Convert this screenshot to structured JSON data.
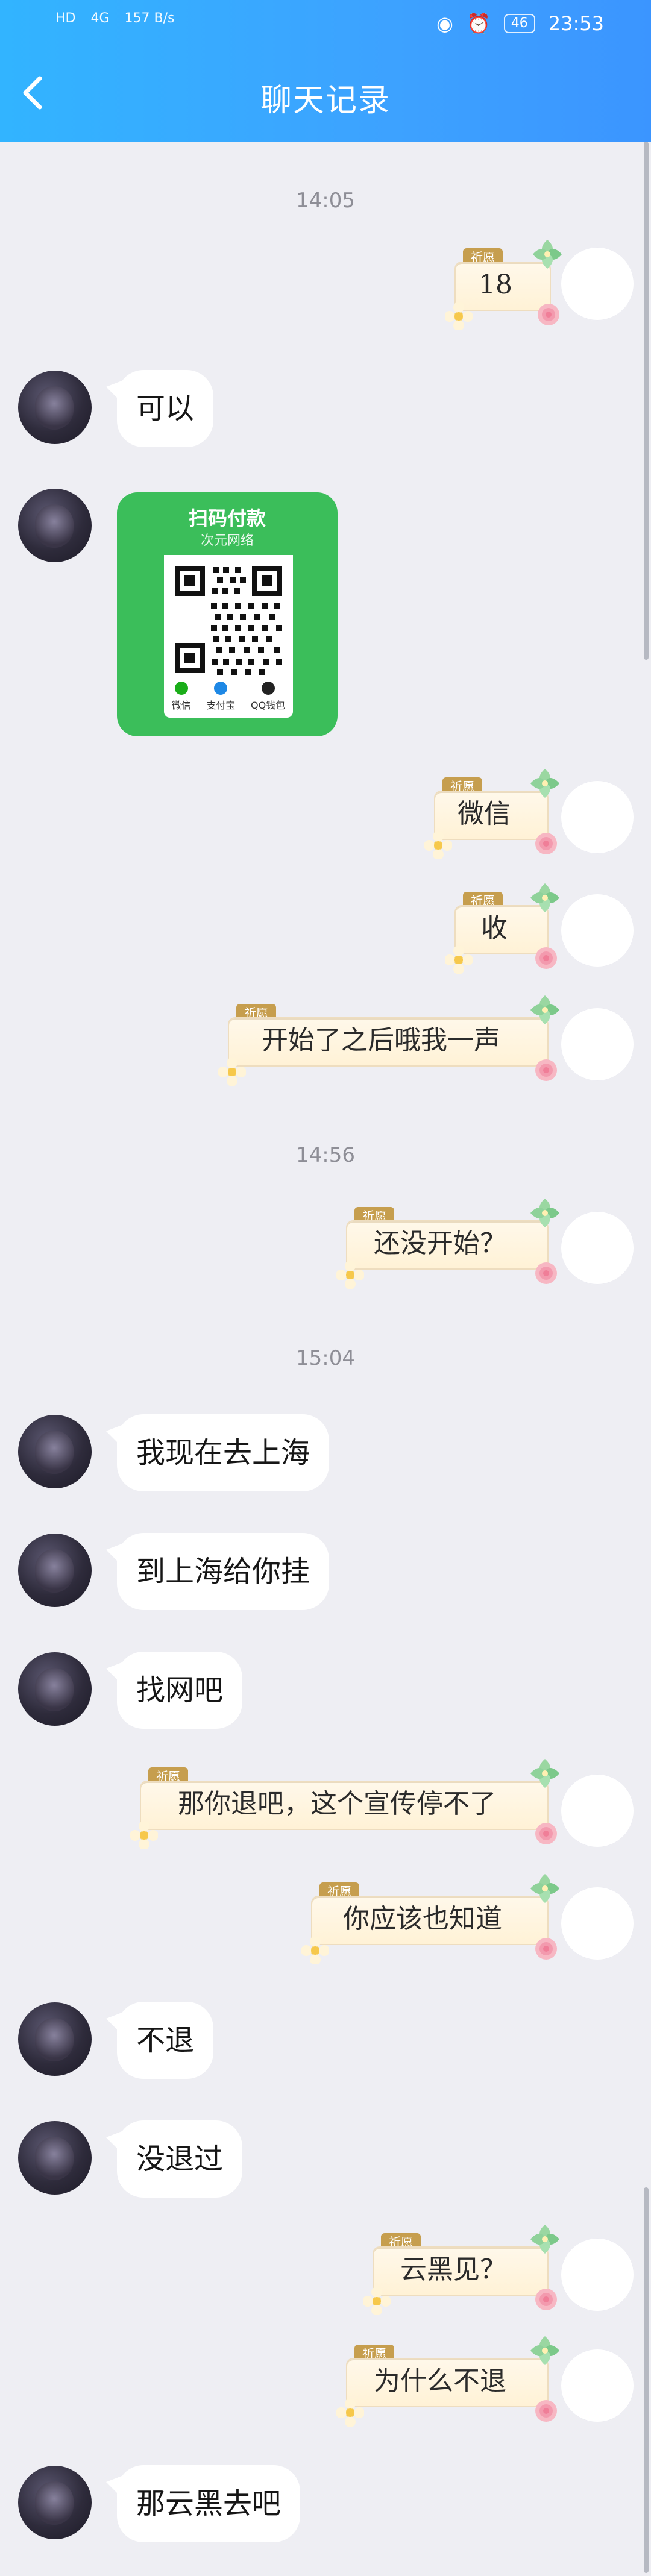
{
  "status": {
    "left": [
      "HD",
      "4G",
      "157 B/s"
    ],
    "right_time": "23:53",
    "battery": "46"
  },
  "header": {
    "title": "聊天记录",
    "back_icon": "chevron-left-icon"
  },
  "messages": {
    "time_1": "14:05",
    "time_2": "14:56",
    "time_3": "15:04",
    "r1": "18",
    "l1": "可以",
    "qr": {
      "title": "扫码付款",
      "subtitle": "次元网络",
      "icons": [
        "微信",
        "支付宝",
        "QQ钱包"
      ]
    },
    "r2": "微信",
    "r3": "收",
    "r4": "开始了之后哦我一声",
    "r5": "还没开始？",
    "l2": "我现在去上海",
    "l3": "到上海给你挂",
    "l4": "找网吧",
    "r6": "那你退吧，这个宣传停不了",
    "r7": "你应该也知道",
    "l5": "不退",
    "l6": "没退过",
    "r8": "云黑见？",
    "r9": "为什么不退",
    "l7": "那云黑去吧"
  },
  "tags": {
    "sender_tag": "祈愿"
  },
  "colors": {
    "header_start": "#32B4FF",
    "header_end": "#3B95FF",
    "bg": "#EEEEF3",
    "qr_green": "#3BBE5A"
  }
}
